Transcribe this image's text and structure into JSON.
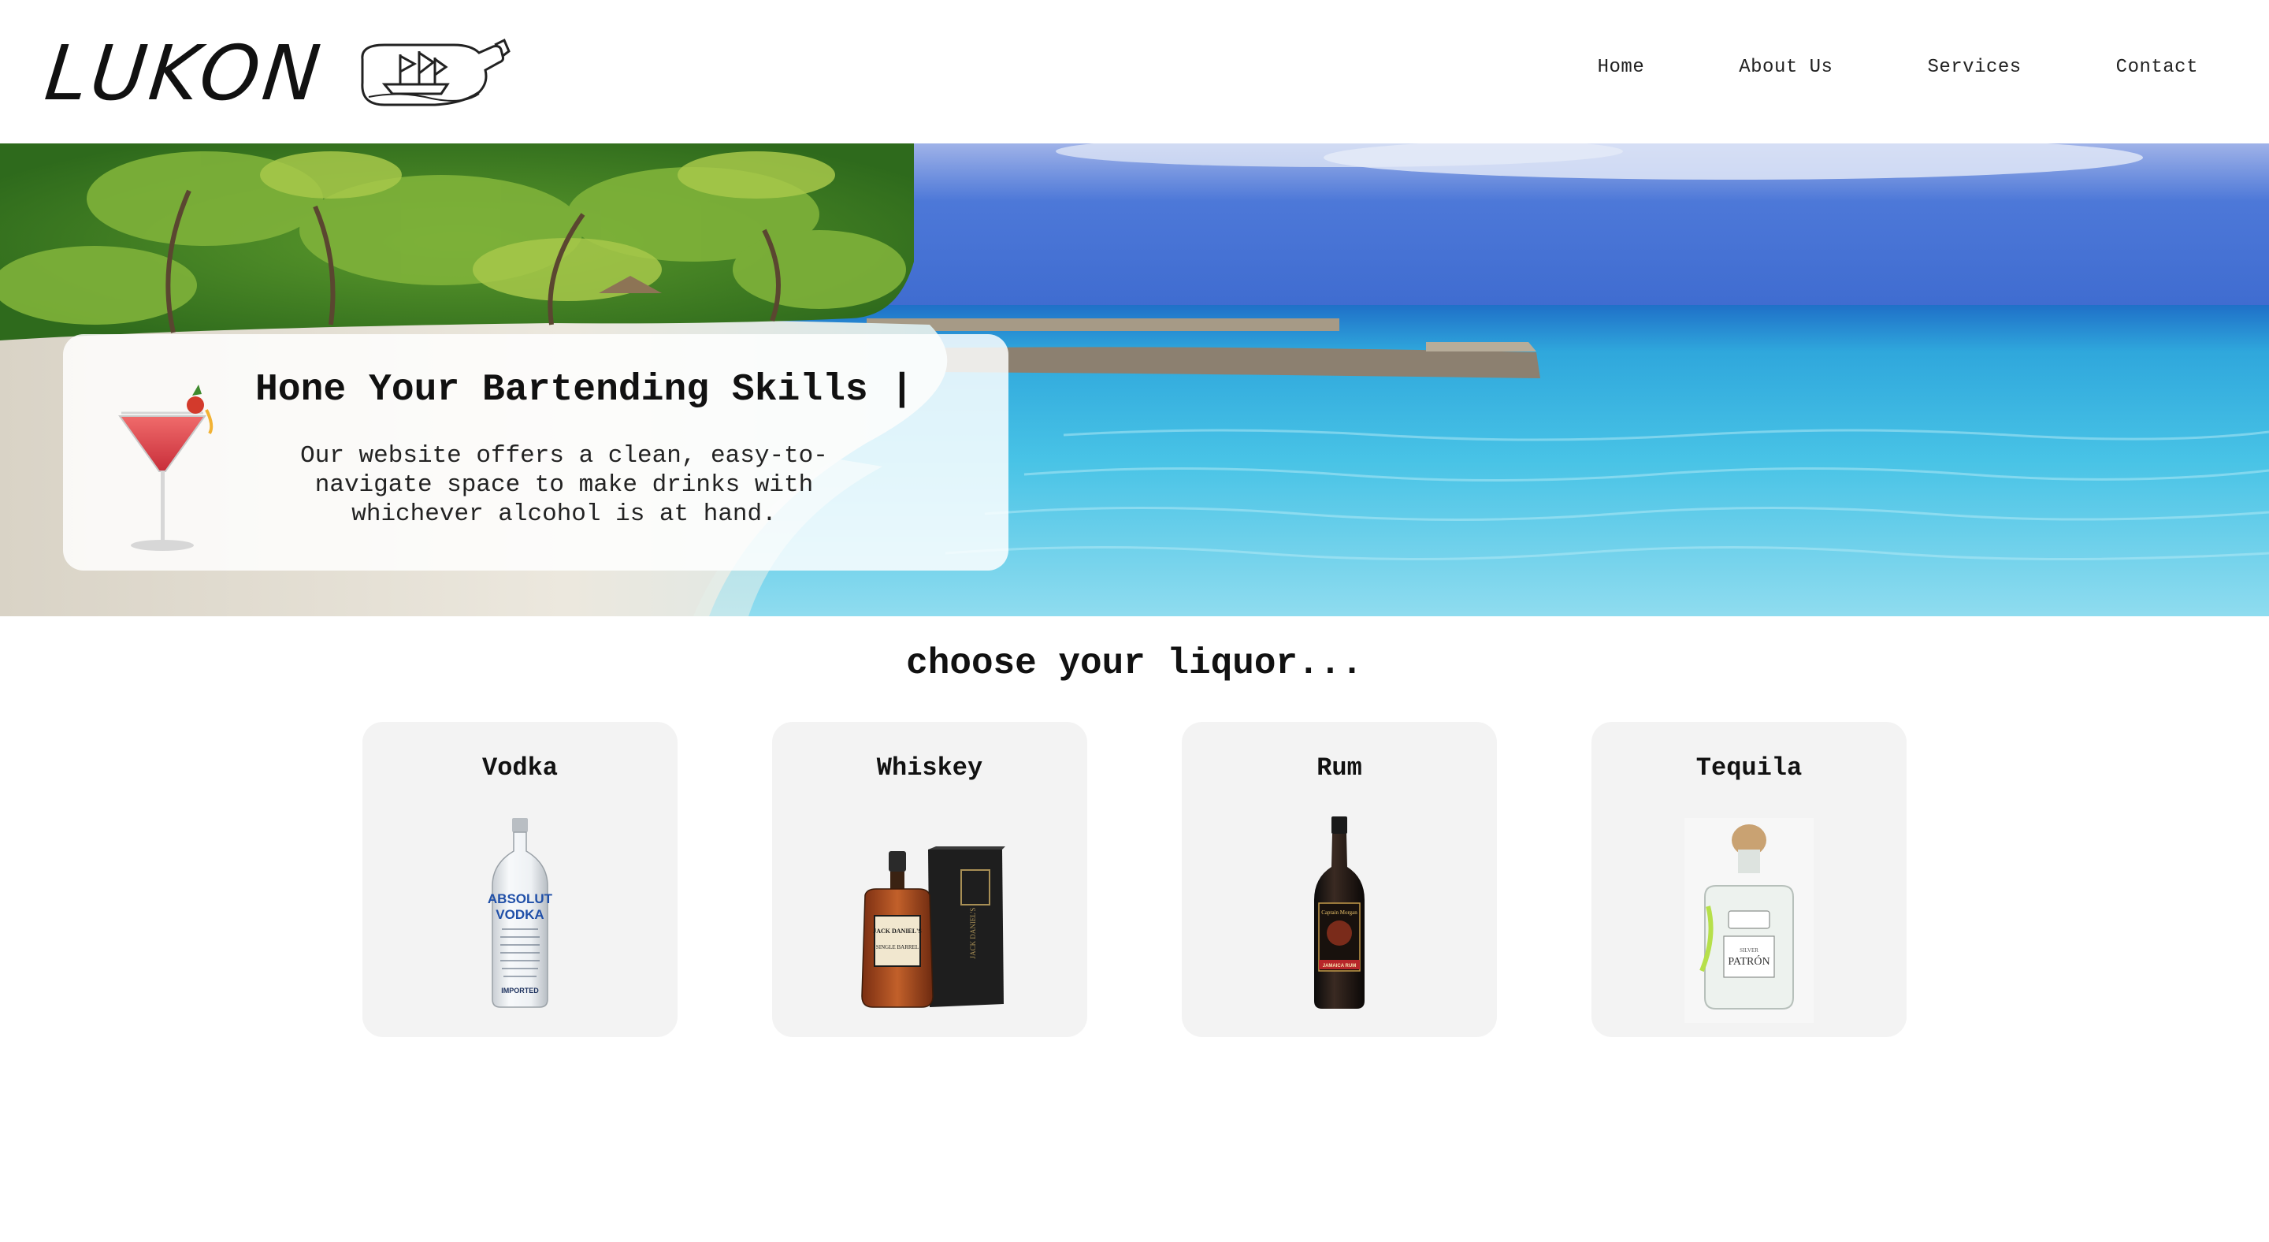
{
  "brand": {
    "name": "LUKON"
  },
  "nav": {
    "items": [
      "Home",
      "About Us",
      "Services",
      "Contact"
    ]
  },
  "hero": {
    "title": "Hone Your Bartending Skills |",
    "description": "Our website offers a clean, easy-to-navigate space to make drinks with whichever alcohol is at hand."
  },
  "section": {
    "title": "choose your liquor..."
  },
  "liquors": [
    {
      "name": "Vodka",
      "label_line1": "ABSOLUT",
      "label_line2": "VODKA",
      "label_footer": "IMPORTED"
    },
    {
      "name": "Whiskey",
      "label_line1": "JACK DANIEL'S",
      "label_line2": "SINGLE BARREL"
    },
    {
      "name": "Rum",
      "label_line1": "Captain Morgan",
      "label_line2": "JAMAICA RUM"
    },
    {
      "name": "Tequila",
      "label_line1": "PATRÓN",
      "label_line2": "SILVER"
    }
  ],
  "colors": {
    "card_bg": "#f3f3f3",
    "hero_card_bg": "rgba(255,255,255,0.84)",
    "sea": "#36b5dc",
    "sky": "#4a78d6"
  }
}
